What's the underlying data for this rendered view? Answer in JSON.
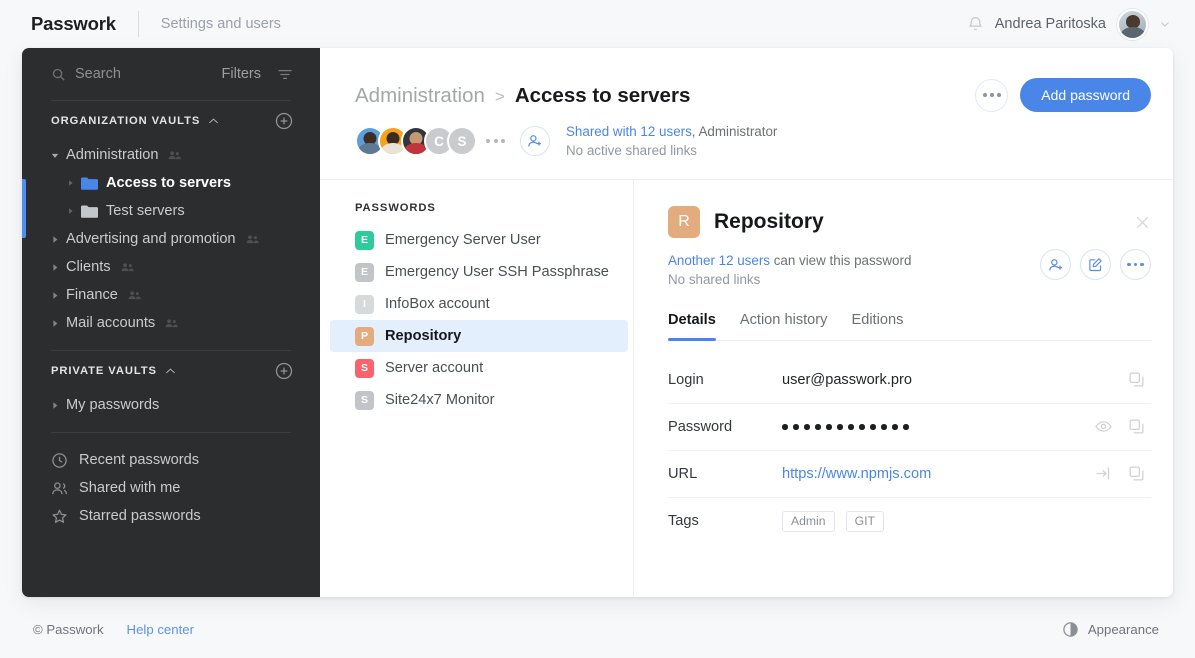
{
  "topbar": {
    "brand": "Passwork",
    "settings_link": "Settings and users",
    "bell_icon": "bell-icon",
    "username": "Andrea Paritoska",
    "chevron_icon": "chevron-down-icon"
  },
  "sidebar": {
    "search_placeholder": "Search",
    "search_icon": "search-icon",
    "filters_label": "Filters",
    "filter_icon": "filter-icon",
    "org_section": {
      "title": "Organization vaults",
      "collapse_icon": "chevron-up-icon",
      "add_icon": "plus-circle-icon"
    },
    "org_items": [
      {
        "label": "Administration",
        "level": 0,
        "expanded": true,
        "shared": true,
        "active": false,
        "folder": null
      },
      {
        "label": "Access to servers",
        "level": 1,
        "expanded": false,
        "shared": false,
        "active": true,
        "folder": "blue"
      },
      {
        "label": "Test servers",
        "level": 1,
        "expanded": false,
        "shared": false,
        "active": false,
        "folder": "gray"
      },
      {
        "label": "Advertising and promotion",
        "level": 0,
        "expanded": false,
        "shared": true,
        "active": false,
        "folder": null
      },
      {
        "label": "Clients",
        "level": 0,
        "expanded": false,
        "shared": true,
        "active": false,
        "folder": null
      },
      {
        "label": "Finance",
        "level": 0,
        "expanded": false,
        "shared": true,
        "active": false,
        "folder": null
      },
      {
        "label": "Mail accounts",
        "level": 0,
        "expanded": false,
        "shared": true,
        "active": false,
        "folder": null
      }
    ],
    "private_section": {
      "title": "Private vaults",
      "collapse_icon": "chevron-up-icon",
      "add_icon": "plus-circle-icon"
    },
    "private_items": [
      {
        "label": "My passwords",
        "level": 0,
        "expanded": false,
        "shared": false,
        "active": false,
        "folder": null
      }
    ],
    "quick_links": [
      {
        "label": "Recent passwords",
        "icon": "clock-icon"
      },
      {
        "label": "Shared with me",
        "icon": "users-icon"
      },
      {
        "label": "Starred passwords",
        "icon": "star-icon"
      }
    ],
    "accent_color": "#4f8ef2"
  },
  "header": {
    "breadcrumb_parent": "Administration",
    "breadcrumb_sep": ">",
    "breadcrumb_current": "Access to servers",
    "avatars": [
      {
        "type": "photo",
        "variant": "a1",
        "label": ""
      },
      {
        "type": "photo",
        "variant": "a2",
        "label": ""
      },
      {
        "type": "photo",
        "variant": "a3",
        "label": ""
      },
      {
        "type": "letter",
        "variant": "",
        "label": "C"
      },
      {
        "type": "letter",
        "variant": "",
        "label": "S"
      }
    ],
    "overflow_icon": "ellipsis-icon",
    "add_user_icon": "add-user-icon",
    "shared_link_text": "Shared with 12 users",
    "shared_suffix": ", Administrator",
    "shared_line2": "No active shared links",
    "more_icon": "ellipsis-icon",
    "add_password_label": "Add password",
    "primary_color": "#4a86e8"
  },
  "password_list": {
    "title": "Passwords",
    "items": [
      {
        "name": "Emergency Server User",
        "letter": "E",
        "color": "#2ecc9b",
        "selected": false
      },
      {
        "name": "Emergency User SSH Passphrase",
        "letter": "E",
        "color": "#c1c4c8",
        "selected": false
      },
      {
        "name": "InfoBox account",
        "letter": "I",
        "color": "#d7dadd",
        "selected": false
      },
      {
        "name": "Repository",
        "letter": "P",
        "color": "#e3ac7f",
        "selected": true
      },
      {
        "name": "Server account",
        "letter": "S",
        "color": "#f9636b",
        "selected": false
      },
      {
        "name": "Site24x7 Monitor",
        "letter": "S",
        "color": "#c1c4c8",
        "selected": false
      }
    ]
  },
  "detail": {
    "badge_letter": "R",
    "badge_color": "#e3ac7f",
    "title": "Repository",
    "close_icon": "close-icon",
    "share_link_text": "Another 12 users",
    "share_suffix": " can view this password",
    "share_line2": "No shared links",
    "actions": [
      {
        "icon": "add-user-icon",
        "name": "share-button"
      },
      {
        "icon": "edit-icon",
        "name": "edit-button"
      },
      {
        "icon": "ellipsis-icon",
        "name": "more-button"
      }
    ],
    "tabs": [
      {
        "label": "Details",
        "active": true
      },
      {
        "label": "Action history",
        "active": false
      },
      {
        "label": "Editions",
        "active": false
      }
    ],
    "fields": [
      {
        "label": "Login",
        "value": "user@passwork.pro",
        "type": "text",
        "icons": [
          "copy-icon"
        ]
      },
      {
        "label": "Password",
        "value": "••••••••••••",
        "dots": 12,
        "type": "secret",
        "icons": [
          "eye-icon",
          "copy-icon"
        ]
      },
      {
        "label": "URL",
        "value": "https://www.npmjs.com",
        "type": "link",
        "icons": [
          "open-link-icon",
          "copy-icon"
        ]
      },
      {
        "label": "Tags",
        "value": "",
        "type": "tags",
        "tags": [
          "Admin",
          "GIT"
        ],
        "icons": []
      }
    ]
  },
  "footer": {
    "copyright": "© Passwork",
    "help_link": "Help center",
    "appearance_icon": "half-circle-icon",
    "appearance_label": "Appearance"
  }
}
